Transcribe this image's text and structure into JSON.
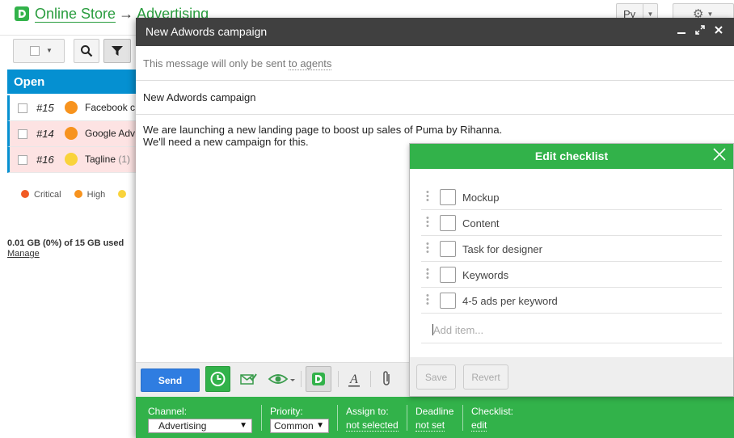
{
  "header": {
    "store": "Online Store",
    "arrow": "→",
    "section": "Advertising",
    "lang": "Ру"
  },
  "ticket_list": {
    "header": "Open",
    "rows": [
      {
        "num": "#15",
        "title": "Facebook c",
        "count": "",
        "priority_color": "#f7931e",
        "bg": "#ffffff"
      },
      {
        "num": "#14",
        "title": "Google Adv",
        "count": "",
        "priority_color": "#f7931e",
        "bg": "#fde3e3"
      },
      {
        "num": "#16",
        "title": "Tagline",
        "count": "(1)",
        "priority_color": "#f9d33b",
        "bg": "#fde3e3"
      }
    ],
    "legend": [
      {
        "label": "Critical",
        "color": "#f15a24"
      },
      {
        "label": "High",
        "color": "#f7931e"
      },
      {
        "label": "",
        "color": "#f9d33b"
      }
    ],
    "storage": "0.01 GB (0%) of 15 GB used",
    "manage": "Manage"
  },
  "compose": {
    "title": "New Adwords campaign",
    "notice_prefix": "This message will only be sent ",
    "notice_link": "to agents",
    "subject": "New Adwords campaign",
    "body_line1": "We are launching a new landing page to boost up sales of Puma by Rihanna.",
    "body_line2": "We'll need a new campaign for this.",
    "send": "Send",
    "props": {
      "channel_label": "Channel:",
      "channel_value": "Advertising",
      "priority_label": "Priority:",
      "priority_value": "Common",
      "assign_label": "Assign to:",
      "assign_value": "not selected",
      "deadline_label": "Deadline",
      "deadline_value": "not set",
      "checklist_label": "Checklist:",
      "checklist_value": "edit"
    }
  },
  "checklist": {
    "title": "Edit checklist",
    "items": [
      "Mockup",
      "Content",
      "Task for designer",
      "Keywords",
      "4-5 ads per keyword"
    ],
    "add_placeholder": "Add item...",
    "save": "Save",
    "revert": "Revert"
  },
  "colors": {
    "accent_green": "#32b24a",
    "open_blue": "#0590d1",
    "send_blue": "#2f7de1",
    "title_bar": "#404040"
  }
}
